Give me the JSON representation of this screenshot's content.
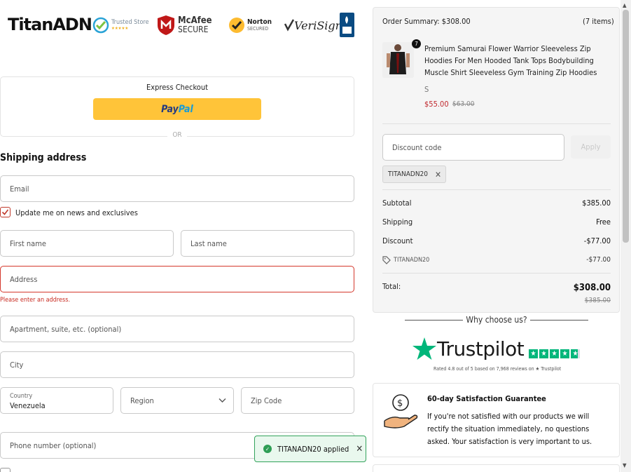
{
  "header": {
    "brand": "TitanADN",
    "badges": [
      {
        "name": "trusted-store",
        "line1": "Trusted Store",
        "line2": "★★★★★"
      },
      {
        "name": "mcafee",
        "line1": "McAfee",
        "line2": "SECURE"
      },
      {
        "name": "norton",
        "line1": "Norton",
        "line2": "SECURED"
      },
      {
        "name": "verisign",
        "line1": "VeriSign"
      }
    ]
  },
  "express": {
    "title": "Express Checkout",
    "paypal_a": "Pay",
    "paypal_b": "Pal",
    "or": "OR"
  },
  "shipping": {
    "title": "Shipping address",
    "email": "Email",
    "newsletter": "Update me on news and exclusives",
    "first_name": "First name",
    "last_name": "Last name",
    "address": "Address",
    "address_error": "Please enter an address.",
    "apartment": "Apartment, suite, etc. (optional)",
    "city": "City",
    "country_label": "Country",
    "country_value": "Venezuela",
    "region": "Region",
    "zip": "Zip Code",
    "phone": "Phone number (optional)"
  },
  "summary": {
    "header": "Order Summary: $308.00",
    "items_count": "(7 items)",
    "product": {
      "qty": "7",
      "title": "Premium Samurai Flower Warrior Sleeveless Zip Hoodies For Men Hooded Tank Tops Bodybuilding Muscle Shirt Sleeveless Gym Training Zip Hoodies",
      "variant": "S",
      "price": "$55.00",
      "old_price": "$63.00"
    },
    "discount_placeholder": "Discount code",
    "apply": "Apply",
    "applied_code": "TITANADN20",
    "rows": {
      "subtotal_label": "Subtotal",
      "subtotal_value": "$385.00",
      "shipping_label": "Shipping",
      "shipping_value": "Free",
      "discount_label": "Discount",
      "discount_value": "-$77.00",
      "code_label": "TITANADN20",
      "code_value": "-$77.00"
    },
    "total_label": "Total:",
    "total_value": "$308.00",
    "total_old": "$385.00"
  },
  "trust": {
    "why": "Why choose us?",
    "trustpilot": "Trustpilot",
    "rating_text": "Rated 4.8 out of 5 based on 7,968 reviews on ★ Trustpilot",
    "guarantee_title": "60-day Satisfaction Guarantee",
    "guarantee_text": "If you're not satisfied with our products we will rectify the situation immediately, no questions asked. Your satisfaction is very important to us."
  },
  "toast": {
    "text": "TITANADN20 applied"
  }
}
